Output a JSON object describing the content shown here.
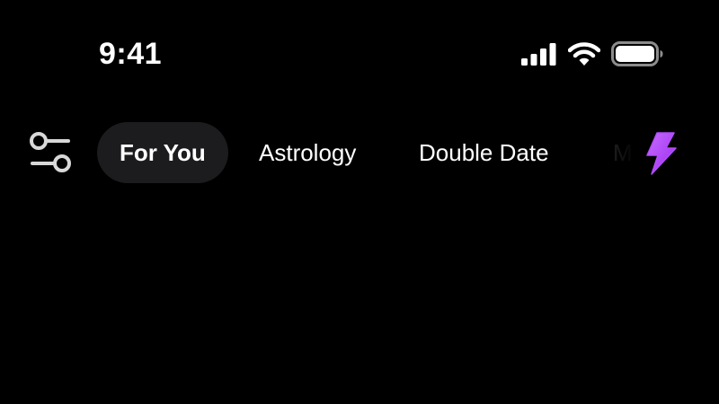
{
  "status_bar": {
    "time": "9:41",
    "icons": [
      "cellular-signal-icon",
      "wifi-icon",
      "battery-icon"
    ],
    "battery_level": 1.0
  },
  "tab_bar": {
    "filter_icon": "filter-sliders-icon",
    "tabs": [
      {
        "label": "For You",
        "active": true
      },
      {
        "label": "Astrology",
        "active": false
      },
      {
        "label": "Double Date",
        "active": false
      },
      {
        "label": "M",
        "active": false
      }
    ],
    "boost_icon": "lightning-bolt-icon",
    "colors": {
      "background": "#000000",
      "active_tab_bg": "#1c1c1e",
      "text": "#ffffff",
      "accent": "#b44dff"
    }
  }
}
